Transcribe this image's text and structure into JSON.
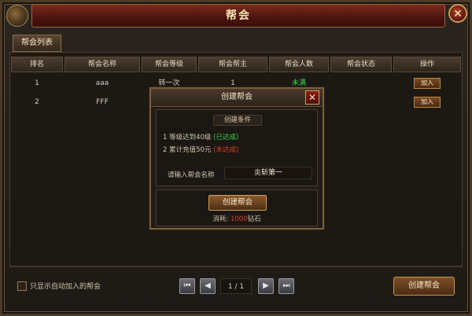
{
  "window": {
    "title": "帮会",
    "close_glyph": "✕"
  },
  "tabs": [
    {
      "label": "帮会列表"
    }
  ],
  "table": {
    "columns": [
      "排名",
      "帮会名称",
      "帮会等级",
      "帮会帮主",
      "帮会人数",
      "帮会状态",
      "操作"
    ],
    "rows": [
      {
        "rank": "1",
        "name": "aaa",
        "level": "转一次",
        "leader": "1",
        "members": "未满",
        "status": "",
        "action": "加入"
      },
      {
        "rank": "2",
        "name": "FFF",
        "level": "",
        "leader": "",
        "members": "",
        "status": "",
        "action": "加入"
      }
    ]
  },
  "footer": {
    "auto_join_label": "只显示自动加入的帮会",
    "page": "1 / 1",
    "first_glyph": "⏮",
    "prev_glyph": "◀",
    "next_glyph": "▶",
    "last_glyph": "⏭",
    "create_button": "创建帮会"
  },
  "modal": {
    "title": "创建帮会",
    "close_glyph": "✕",
    "conditions_title": "创建条件",
    "conditions": [
      {
        "text": "1 等级达到40级",
        "status": "(已达成)"
      },
      {
        "text": "2 累计充值50元",
        "status": "(未达成)"
      }
    ],
    "name_label": "请输入帮会名称",
    "name_value": "炎斩第一",
    "create_button": "创建帮会",
    "cost_label": "消耗:",
    "cost_amount": "1000",
    "cost_unit": "钻石"
  },
  "colors": {
    "done": "#38d24a",
    "not_done": "#e23c2c",
    "title_red": "#6a1e14",
    "gold": "#c89850"
  }
}
